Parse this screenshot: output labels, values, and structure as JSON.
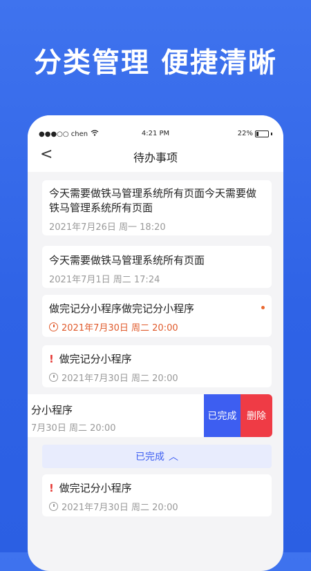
{
  "promo": {
    "title": "分类管理 便捷清晰"
  },
  "statusbar": {
    "carrier": "●●●○○ chen",
    "time": "4:21 PM",
    "battery": "22%"
  },
  "navbar": {
    "back": "<",
    "title": "待办事项"
  },
  "tasks": [
    {
      "title": "今天需要做铁马管理系统所有页面今天需要做铁马管理系统所有页面",
      "date": "2021年7月26日 周一  18:20"
    },
    {
      "title": "今天需要做铁马管理系统所有页面",
      "date": "2021年7月1日 周二 17:24"
    },
    {
      "title": "做完记分小程序做完记分小程序",
      "date": "2021年7月30日 周二 20:00"
    },
    {
      "important": "!",
      "title": "做完记分小程序",
      "date": "2021年7月30日 周二 20:00"
    }
  ],
  "swipe_task": {
    "title": "分小程序",
    "date": "7月30日 周二 20:00",
    "done_label": "已完成",
    "delete_label": "删除"
  },
  "completed_section": {
    "label": "已完成",
    "arrow": "︿"
  },
  "completed_tasks": [
    {
      "important": "!",
      "title": "做完记分小程序",
      "date": "2021年7月30日 周二 20:00"
    }
  ],
  "colors": {
    "brand_blue": "#3d5ef1",
    "danger_red": "#ef3b45",
    "alarm_orange": "#e05a2b"
  }
}
